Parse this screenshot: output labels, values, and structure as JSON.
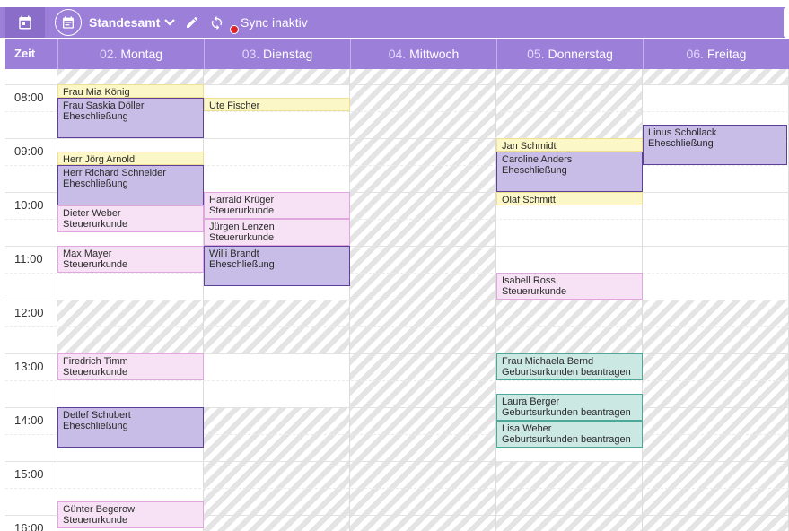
{
  "toolbar": {
    "calendar_name": "Standesamt",
    "sync_status": "Sync inaktiv"
  },
  "header": {
    "zeit_label": "Zeit",
    "days": [
      {
        "num": "02.",
        "name": "Montag"
      },
      {
        "num": "03.",
        "name": "Dienstag"
      },
      {
        "num": "04.",
        "name": "Mittwoch"
      },
      {
        "num": "05.",
        "name": "Donnerstag"
      },
      {
        "num": "06.",
        "name": "Freitag"
      }
    ]
  },
  "times": [
    "08:00",
    "09:00",
    "10:00",
    "11:00",
    "12:00",
    "13:00",
    "14:00",
    "15:00",
    "16:00"
  ],
  "events": {
    "mon": [
      {
        "line1": "Frau Mia König"
      },
      {
        "line1": "Frau Saskia Döller",
        "line2": "Eheschließung"
      },
      {
        "line1": "Herr Jörg Arnold"
      },
      {
        "line1": "Herr Richard Schneider",
        "line2": "Eheschließung"
      },
      {
        "line1": "Dieter Weber",
        "line2": "Steuerurkunde"
      },
      {
        "line1": "Max Mayer",
        "line2": "Steuerurkunde"
      },
      {
        "line1": "Firedrich Timm",
        "line2": "Steuerurkunde"
      },
      {
        "line1": "Detlef Schubert",
        "line2": "Eheschließung"
      },
      {
        "line1": "Günter Begerow",
        "line2": "Steuerurkunde"
      }
    ],
    "tue": [
      {
        "line1": "Ute Fischer"
      },
      {
        "line1": "Harrald Krüger",
        "line2": "Steuerurkunde"
      },
      {
        "line1": "Jürgen Lenzen",
        "line2": "Steuerurkunde"
      },
      {
        "line1": "Willi Brandt",
        "line2": "Eheschließung"
      }
    ],
    "thu": [
      {
        "line1": "Jan Schmidt"
      },
      {
        "line1": "Caroline Anders",
        "line2": "Eheschließung"
      },
      {
        "line1": "Olaf Schmitt"
      },
      {
        "line1": "Isabell Ross",
        "line2": "Steuerurkunde"
      },
      {
        "line1": "Frau Michaela Bernd",
        "line2": "Geburtsurkunden beantragen"
      },
      {
        "line1": "Laura Berger",
        "line2": "Geburtsurkunden beantragen"
      },
      {
        "line1": "Lisa Weber",
        "line2": "Geburtsurkunden beantragen"
      }
    ],
    "fri": [
      {
        "line1": "Linus Schollack",
        "line2": "Eheschließung"
      }
    ]
  },
  "colors": {
    "toolbar": "#9b7fd9",
    "event_yellow": "#fcf7c6",
    "event_pink": "#f6e2f4",
    "event_purple": "#c7bde6",
    "event_teal": "#cce8e3",
    "sync_dot": "#d8262c"
  },
  "icons": [
    "calendar-icon",
    "calendar-circle-icon",
    "chevron-down-icon",
    "pencil-icon",
    "sync-icon",
    "status-dot-icon"
  ]
}
